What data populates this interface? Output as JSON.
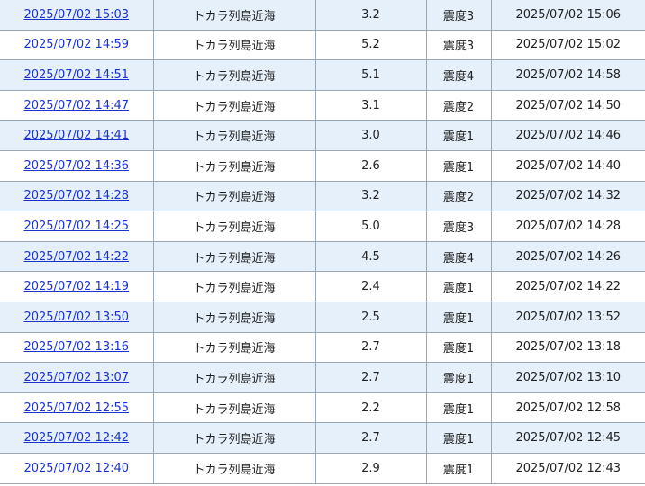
{
  "quakes": [
    {
      "time": "2025/07/02 15:03",
      "place": "トカラ列島近海",
      "magnitude": "3.2",
      "intensity": "震度3",
      "published": "2025/07/02 15:06"
    },
    {
      "time": "2025/07/02 14:59",
      "place": "トカラ列島近海",
      "magnitude": "5.2",
      "intensity": "震度3",
      "published": "2025/07/02 15:02"
    },
    {
      "time": "2025/07/02 14:51",
      "place": "トカラ列島近海",
      "magnitude": "5.1",
      "intensity": "震度4",
      "published": "2025/07/02 14:58"
    },
    {
      "time": "2025/07/02 14:47",
      "place": "トカラ列島近海",
      "magnitude": "3.1",
      "intensity": "震度2",
      "published": "2025/07/02 14:50"
    },
    {
      "time": "2025/07/02 14:41",
      "place": "トカラ列島近海",
      "magnitude": "3.0",
      "intensity": "震度1",
      "published": "2025/07/02 14:46"
    },
    {
      "time": "2025/07/02 14:36",
      "place": "トカラ列島近海",
      "magnitude": "2.6",
      "intensity": "震度1",
      "published": "2025/07/02 14:40"
    },
    {
      "time": "2025/07/02 14:28",
      "place": "トカラ列島近海",
      "magnitude": "3.2",
      "intensity": "震度2",
      "published": "2025/07/02 14:32"
    },
    {
      "time": "2025/07/02 14:25",
      "place": "トカラ列島近海",
      "magnitude": "5.0",
      "intensity": "震度3",
      "published": "2025/07/02 14:28"
    },
    {
      "time": "2025/07/02 14:22",
      "place": "トカラ列島近海",
      "magnitude": "4.5",
      "intensity": "震度4",
      "published": "2025/07/02 14:26"
    },
    {
      "time": "2025/07/02 14:19",
      "place": "トカラ列島近海",
      "magnitude": "2.4",
      "intensity": "震度1",
      "published": "2025/07/02 14:22"
    },
    {
      "time": "2025/07/02 13:50",
      "place": "トカラ列島近海",
      "magnitude": "2.5",
      "intensity": "震度1",
      "published": "2025/07/02 13:52"
    },
    {
      "time": "2025/07/02 13:16",
      "place": "トカラ列島近海",
      "magnitude": "2.7",
      "intensity": "震度1",
      "published": "2025/07/02 13:18"
    },
    {
      "time": "2025/07/02 13:07",
      "place": "トカラ列島近海",
      "magnitude": "2.7",
      "intensity": "震度1",
      "published": "2025/07/02 13:10"
    },
    {
      "time": "2025/07/02 12:55",
      "place": "トカラ列島近海",
      "magnitude": "2.2",
      "intensity": "震度1",
      "published": "2025/07/02 12:58"
    },
    {
      "time": "2025/07/02 12:42",
      "place": "トカラ列島近海",
      "magnitude": "2.7",
      "intensity": "震度1",
      "published": "2025/07/02 12:45"
    },
    {
      "time": "2025/07/02 12:40",
      "place": "トカラ列島近海",
      "magnitude": "2.9",
      "intensity": "震度1",
      "published": "2025/07/02 12:43"
    }
  ]
}
